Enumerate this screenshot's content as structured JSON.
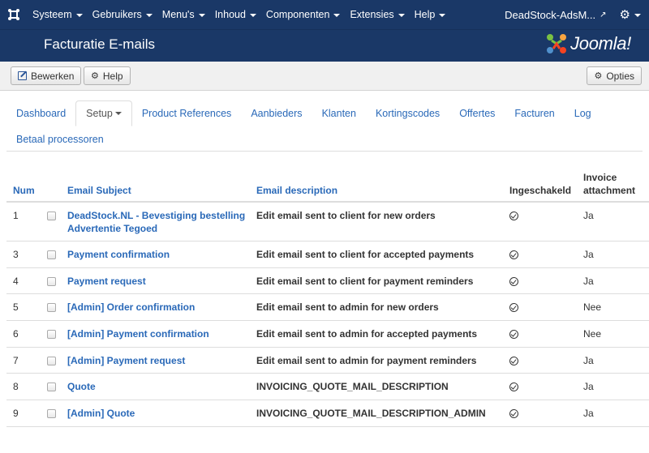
{
  "topnav": {
    "menu": [
      {
        "label": "Systeem"
      },
      {
        "label": "Gebruikers"
      },
      {
        "label": "Menu's"
      },
      {
        "label": "Inhoud"
      },
      {
        "label": "Componenten"
      },
      {
        "label": "Extensies"
      },
      {
        "label": "Help"
      }
    ],
    "site_name": "DeadStock-AdsM..."
  },
  "header": {
    "title": "Facturatie E-mails",
    "brand": "Joomla!"
  },
  "toolbar": {
    "edit_label": "Bewerken",
    "help_label": "Help",
    "options_label": "Opties"
  },
  "tabs": {
    "row1": [
      {
        "label": "Dashboard",
        "active": false
      },
      {
        "label": "Setup",
        "active": true,
        "dropdown": true
      },
      {
        "label": "Product References",
        "active": false
      },
      {
        "label": "Aanbieders",
        "active": false
      },
      {
        "label": "Klanten",
        "active": false
      },
      {
        "label": "Kortingscodes",
        "active": false
      },
      {
        "label": "Offertes",
        "active": false
      },
      {
        "label": "Facturen",
        "active": false
      },
      {
        "label": "Log",
        "active": false
      }
    ],
    "row2": [
      {
        "label": "Betaal processoren",
        "active": false
      }
    ]
  },
  "table": {
    "headers": {
      "num": "Num",
      "subject": "Email Subject",
      "description": "Email description",
      "enabled": "Ingeschakeld",
      "attachment_line1": "Invoice",
      "attachment_line2": "attachment"
    },
    "rows": [
      {
        "num": "1",
        "subject": "DeadStock.NL - Bevestiging bestelling Advertentie Tegoed",
        "description": "Edit email sent to client for new orders",
        "attachment": "Ja"
      },
      {
        "num": "3",
        "subject": "Payment confirmation",
        "description": "Edit email sent to client for accepted payments",
        "attachment": "Ja"
      },
      {
        "num": "4",
        "subject": "Payment request",
        "description": "Edit email sent to client for payment reminders",
        "attachment": "Ja"
      },
      {
        "num": "5",
        "subject": "[Admin] Order confirmation",
        "description": "Edit email sent to admin for new orders",
        "attachment": "Nee"
      },
      {
        "num": "6",
        "subject": "[Admin] Payment confirmation",
        "description": "Edit email sent to admin for accepted payments",
        "attachment": "Nee"
      },
      {
        "num": "7",
        "subject": "[Admin] Payment request",
        "description": "Edit email sent to admin for payment reminders",
        "attachment": "Ja"
      },
      {
        "num": "8",
        "subject": "Quote",
        "description": "INVOICING_QUOTE_MAIL_DESCRIPTION",
        "attachment": "Ja"
      },
      {
        "num": "9",
        "subject": "[Admin] Quote",
        "description": "INVOICING_QUOTE_MAIL_DESCRIPTION_ADMIN",
        "attachment": "Ja"
      }
    ]
  },
  "colors": {
    "nav_bg": "#1a3867",
    "link": "#2a69b8"
  },
  "icons": {
    "joomla": "joomla-logo-icon",
    "external": "external-link-icon",
    "settings": "gear-icon",
    "edit": "edit-icon",
    "enabled": "check-circle-icon"
  }
}
